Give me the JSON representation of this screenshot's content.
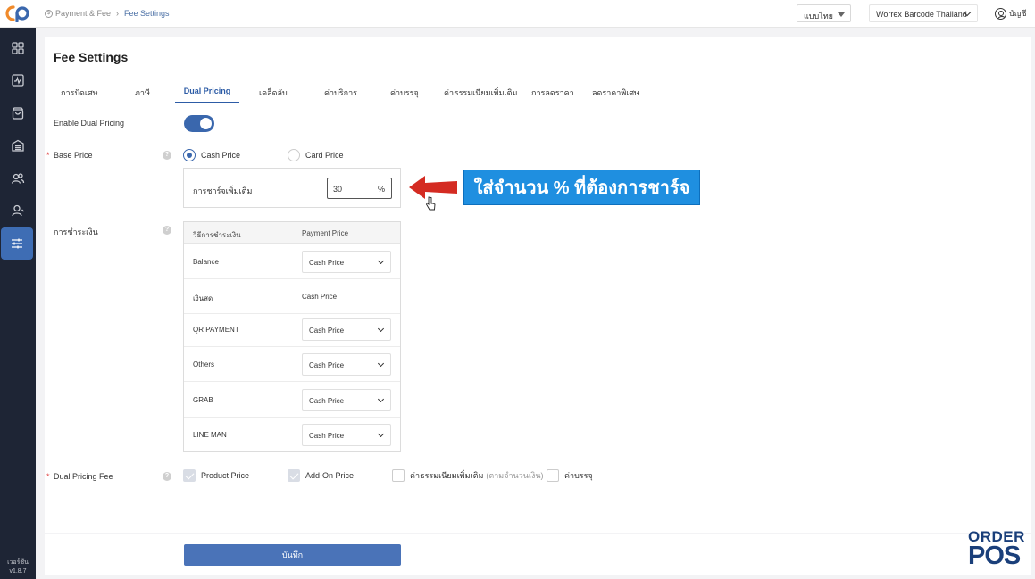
{
  "topbar": {
    "breadcrumb": [
      "Payment & Fee",
      "Fee Settings"
    ],
    "breadcrumb_icon": "dollar-circle-icon",
    "language": "แบบไทย",
    "store": "Worrex Barcode Thailand",
    "account": "บัญชี"
  },
  "sidebar": {
    "items": [
      "dashboard-icon",
      "activity-icon",
      "bag-icon",
      "warehouse-icon",
      "users-icon",
      "user-icon",
      "sliders-icon"
    ],
    "active_index": 6,
    "version_label": "เวอร์ชัน",
    "version": "v1.8.7"
  },
  "page": {
    "title": "Fee Settings",
    "tabs": [
      "การปัดเศษ",
      "ภาษี",
      "Dual Pricing",
      "เคล็ดลับ",
      "ค่าบริการ",
      "ค่าบรรจุ",
      "ค่าธรรมเนียมเพิ่มเติม",
      "การลดราคา",
      "ลดราคาพิเศษ"
    ],
    "active_tab": "Dual Pricing"
  },
  "form": {
    "enable_label": "Enable Dual Pricing",
    "enable_value": true,
    "base_price_label": "Base Price",
    "base_price_options": [
      "Cash Price",
      "Card Price"
    ],
    "base_price_selected": "Cash Price",
    "surcharge_label": "การชาร์จเพิ่มเติม",
    "surcharge_value": "30",
    "surcharge_unit": "%",
    "payment_label": "การชำระเงิน",
    "payment_table": {
      "headers": [
        "วิธีการชำระเงิน",
        "Payment Price"
      ],
      "rows": [
        {
          "method": "Balance",
          "price": "Cash Price",
          "editable": true
        },
        {
          "method": "เงินสด",
          "price": "Cash Price",
          "editable": false
        },
        {
          "method": "QR PAYMENT",
          "price": "Cash Price",
          "editable": true
        },
        {
          "method": "Others",
          "price": "Cash Price",
          "editable": true
        },
        {
          "method": "GRAB",
          "price": "Cash Price",
          "editable": true
        },
        {
          "method": "LINE MAN",
          "price": "Cash Price",
          "editable": true
        }
      ]
    },
    "fee_label": "Dual Pricing Fee",
    "fee_options": [
      {
        "label": "Product Price",
        "checked": true,
        "sub": ""
      },
      {
        "label": "Add-On Price",
        "checked": true,
        "sub": ""
      },
      {
        "label": "ค่าธรรมเนียมเพิ่มเติม",
        "checked": false,
        "sub": "(ตามจำนวนเงิน)"
      },
      {
        "label": "ค่าบรรจุ",
        "checked": false,
        "sub": ""
      }
    ],
    "save_label": "บันทึก"
  },
  "annotation": {
    "callout": "ใส่จำนวน % ที่ต้องการชาร์จ",
    "arrow_color": "#d42b22",
    "callout_color": "#1f8fe0"
  },
  "brand": {
    "line1": "ORDER",
    "line2": "POS"
  },
  "colors": {
    "accent": "#3a67ad",
    "sidebar": "#1e2535"
  }
}
